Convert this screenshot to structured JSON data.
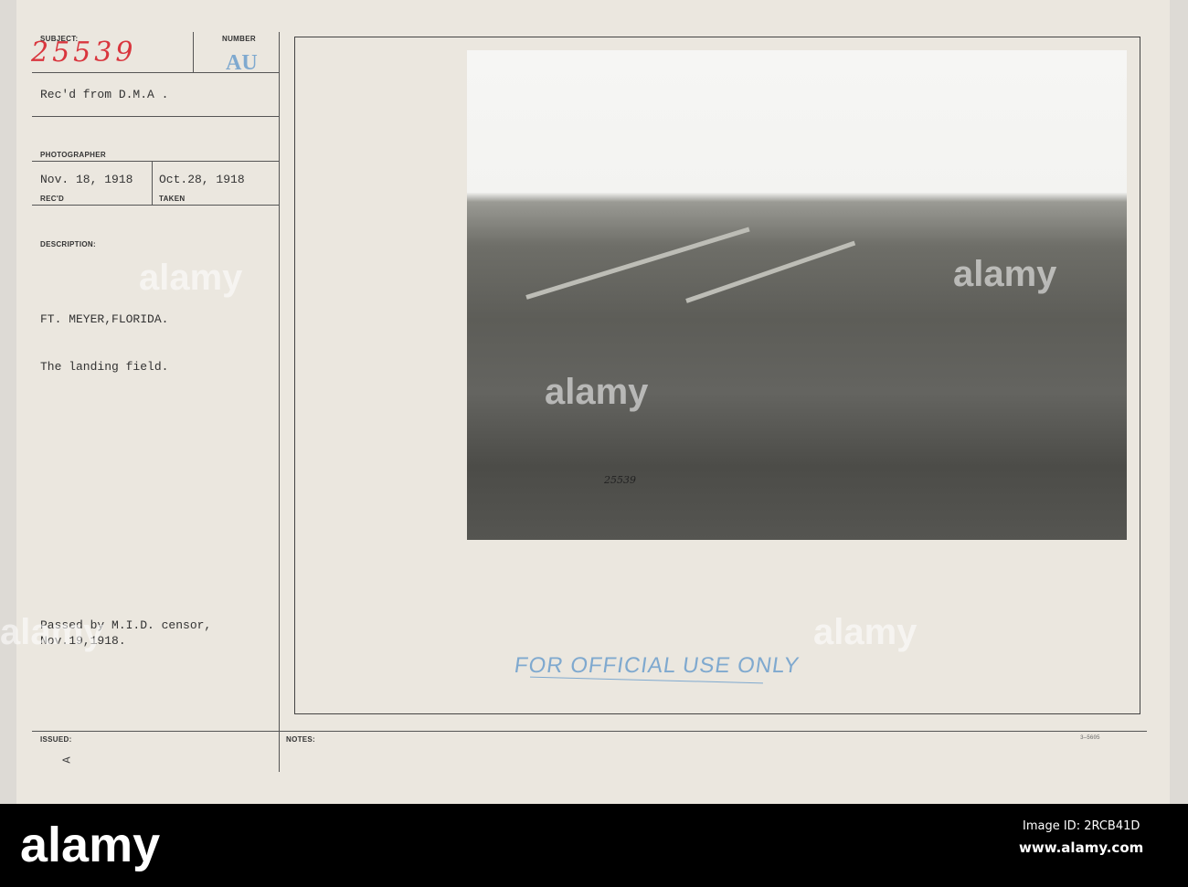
{
  "card": {
    "subject_label": "SUBJECT:",
    "subject_number": "25539",
    "number_label": "NUMBER",
    "number_value": "AU",
    "received_from": "Rec'd from D.M.A .",
    "photographer_label": "PHOTOGRAPHER",
    "recd_date": "Nov. 18, 1918",
    "recd_label": "REC'D",
    "taken_date": "Oct.28, 1918",
    "taken_label": "TAKEN",
    "description_label": "DESCRIPTION:",
    "location": "FT. MEYER,FLORIDA.",
    "caption": "The landing field.",
    "censor_line1": "Passed by M.I.D. censor,",
    "censor_line2": "Nov.19,1918.",
    "issued_label": "ISSUED:",
    "issued_mark": "A",
    "notes_label": "NOTES:",
    "form_number": "3—5605",
    "photo_number": "25539",
    "stamp": "FOR OFFICIAL USE ONLY"
  },
  "watermark": "alamy",
  "footer": {
    "logo": "alamy",
    "image_id": "Image ID: 2RCB41D",
    "url": "www.alamy.com"
  },
  "colors": {
    "subject_ink": "#d9363e",
    "number_ink": "#7fa9cf",
    "stamp_ink": "#7fa9cf"
  }
}
